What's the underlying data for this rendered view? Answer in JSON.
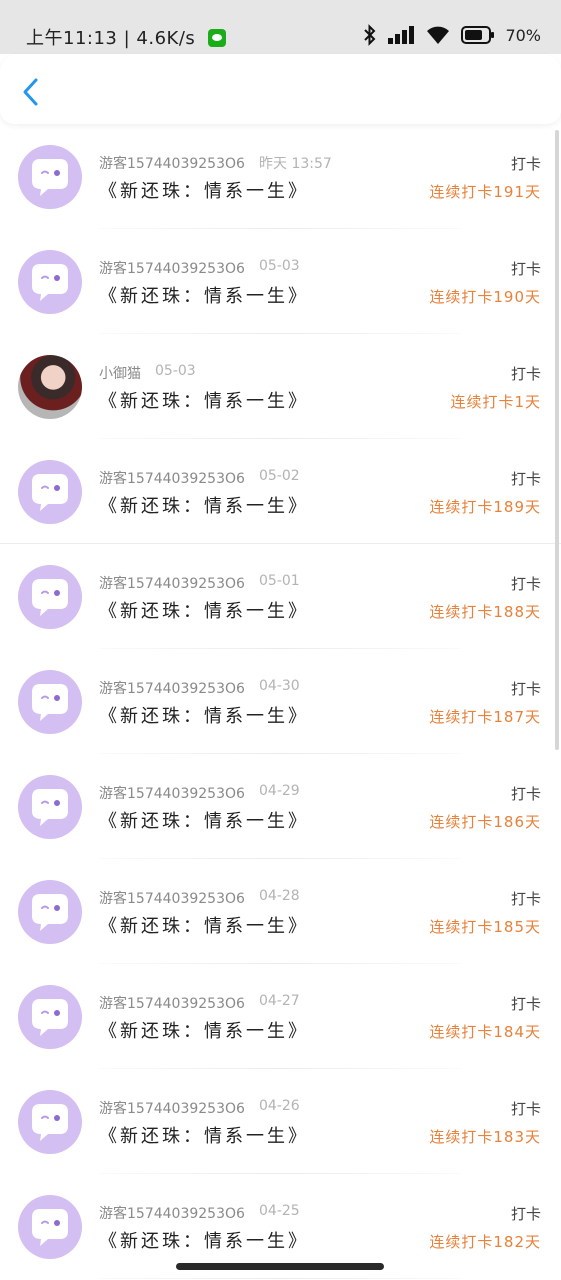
{
  "status_bar": {
    "time": "上午11:13",
    "net_speed": "4.6K/s",
    "battery": "70"
  },
  "colors": {
    "accent": "#2196f3",
    "streak": "#e8813a",
    "avatar_bg": "#d4bff2"
  },
  "entries": [
    {
      "name": "游客15744039253O6",
      "time": "昨天 13:57",
      "title": "《新还珠：情系一生》",
      "action": "打卡",
      "streak": "连续打卡191天",
      "avatar": "chat-bubble"
    },
    {
      "name": "游客15744039253O6",
      "time": "05-03",
      "title": "《新还珠：情系一生》",
      "action": "打卡",
      "streak": "连续打卡190天",
      "avatar": "chat-bubble"
    },
    {
      "name": "小御猫",
      "time": "05-03",
      "title": "《新还珠：情系一生》",
      "action": "打卡",
      "streak": "连续打卡1天",
      "avatar": "photo"
    },
    {
      "name": "游客15744039253O6",
      "time": "05-02",
      "title": "《新还珠：情系一生》",
      "action": "打卡",
      "streak": "连续打卡189天",
      "avatar": "chat-bubble"
    },
    {
      "name": "游客15744039253O6",
      "time": "05-01",
      "title": "《新还珠：情系一生》",
      "action": "打卡",
      "streak": "连续打卡188天",
      "avatar": "chat-bubble"
    },
    {
      "name": "游客15744039253O6",
      "time": "04-30",
      "title": "《新还珠：情系一生》",
      "action": "打卡",
      "streak": "连续打卡187天",
      "avatar": "chat-bubble"
    },
    {
      "name": "游客15744039253O6",
      "time": "04-29",
      "title": "《新还珠：情系一生》",
      "action": "打卡",
      "streak": "连续打卡186天",
      "avatar": "chat-bubble"
    },
    {
      "name": "游客15744039253O6",
      "time": "04-28",
      "title": "《新还珠：情系一生》",
      "action": "打卡",
      "streak": "连续打卡185天",
      "avatar": "chat-bubble"
    },
    {
      "name": "游客15744039253O6",
      "time": "04-27",
      "title": "《新还珠：情系一生》",
      "action": "打卡",
      "streak": "连续打卡184天",
      "avatar": "chat-bubble"
    },
    {
      "name": "游客15744039253O6",
      "time": "04-26",
      "title": "《新还珠：情系一生》",
      "action": "打卡",
      "streak": "连续打卡183天",
      "avatar": "chat-bubble"
    },
    {
      "name": "游客15744039253O6",
      "time": "04-25",
      "title": "《新还珠：情系一生》",
      "action": "打卡",
      "streak": "连续打卡182天",
      "avatar": "chat-bubble"
    }
  ]
}
